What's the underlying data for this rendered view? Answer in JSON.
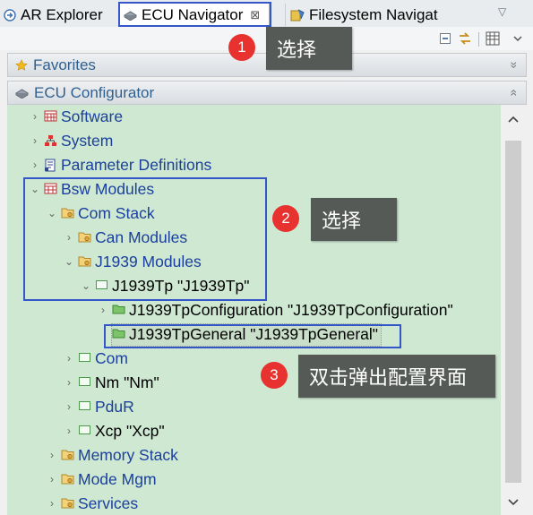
{
  "tabs": [
    {
      "label": "AR Explorer",
      "icon": "arrow-circle-icon"
    },
    {
      "label": "ECU Navigator",
      "icon": "ecu-icon",
      "close": "⊠"
    },
    {
      "label": "Filesystem Navigat",
      "icon": "filesystem-icon"
    }
  ],
  "sections": {
    "favorites": {
      "label": "Favorites",
      "toggle": "»"
    },
    "ecu_configurator": {
      "label": "ECU Configurator",
      "toggle": "«"
    }
  },
  "tree": [
    {
      "label": "Software",
      "level": 0,
      "twisty": "›",
      "icon": "software-icon"
    },
    {
      "label": "System",
      "level": 0,
      "twisty": "›",
      "icon": "system-icon"
    },
    {
      "label": "Parameter Definitions",
      "level": 0,
      "twisty": "›",
      "icon": "param-def-icon"
    },
    {
      "label": "Bsw Modules",
      "level": 0,
      "twisty": "⌄",
      "icon": "bsw-modules-icon"
    },
    {
      "label": "Com Stack",
      "level": 1,
      "twisty": "⌄",
      "icon": "folder-icon"
    },
    {
      "label": "Can Modules",
      "level": 2,
      "twisty": "›",
      "icon": "folder-icon"
    },
    {
      "label": "J1939 Modules",
      "level": 2,
      "twisty": "⌄",
      "icon": "folder-icon"
    },
    {
      "label": "J1939Tp \"J1939Tp\"",
      "level": 3,
      "twisty": "⌄",
      "icon": "module-icon",
      "black": true
    },
    {
      "label": "J1939TpConfiguration \"J1939TpConfiguration\"",
      "level": 4,
      "twisty": "›",
      "icon": "container-icon",
      "black": true
    },
    {
      "label": "J1939TpGeneral \"J1939TpGeneral\"",
      "level": 4,
      "twisty": "",
      "icon": "container-icon",
      "black": true,
      "selected": true
    },
    {
      "label": "Com",
      "level": 2,
      "twisty": "›",
      "icon": "module-icon"
    },
    {
      "label": "Nm \"Nm\"",
      "level": 2,
      "twisty": "›",
      "icon": "module-icon",
      "black": true
    },
    {
      "label": "PduR",
      "level": 2,
      "twisty": "›",
      "icon": "module-icon"
    },
    {
      "label": "Xcp \"Xcp\"",
      "level": 2,
      "twisty": "›",
      "icon": "module-icon",
      "black": true
    },
    {
      "label": "Memory Stack",
      "level": 1,
      "twisty": "›",
      "icon": "folder-icon"
    },
    {
      "label": "Mode Mgm",
      "level": 1,
      "twisty": "›",
      "icon": "folder-icon"
    },
    {
      "label": "Services",
      "level": 1,
      "twisty": "›",
      "icon": "folder-icon"
    }
  ],
  "annotations": [
    {
      "number": "1",
      "text": "选择"
    },
    {
      "number": "2",
      "text": "选择"
    },
    {
      "number": "3",
      "text": "双击弹出配置界面"
    }
  ],
  "colors": {
    "tree_bg": "#cee8d2",
    "link_text": "#1a3f9e",
    "highlight_border": "#3456c8",
    "badge": "#e8322f",
    "callout_bg": "#555a56"
  }
}
